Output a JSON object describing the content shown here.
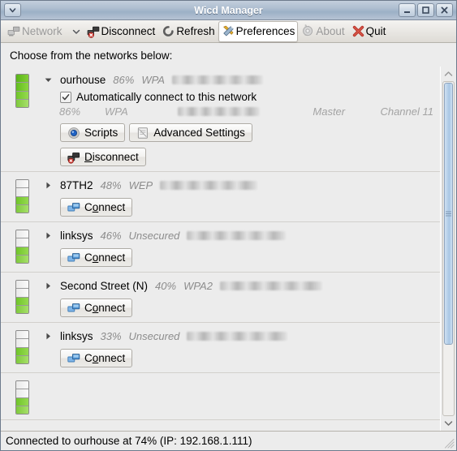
{
  "window": {
    "title": "Wicd Manager",
    "menu_button_icon": "chevron-down-icon",
    "minimize_label": "Minimize",
    "maximize_label": "Maximize",
    "close_label": "Close"
  },
  "toolbar": {
    "items": [
      {
        "label": "Network",
        "icon": "network-icon",
        "has_dropdown": true,
        "enabled": true,
        "active": false
      },
      {
        "label": "Disconnect",
        "icon": "disconnect-icon",
        "has_dropdown": false,
        "enabled": true,
        "active": false
      },
      {
        "label": "Refresh",
        "icon": "refresh-icon",
        "has_dropdown": false,
        "enabled": true,
        "active": false
      },
      {
        "label": "Preferences",
        "icon": "preferences-icon",
        "has_dropdown": false,
        "enabled": true,
        "active": true
      },
      {
        "label": "About",
        "icon": "about-gear-icon",
        "has_dropdown": false,
        "enabled": false,
        "active": false
      },
      {
        "label": "Quit",
        "icon": "quit-x-icon",
        "has_dropdown": false,
        "enabled": true,
        "active": false
      }
    ]
  },
  "main": {
    "prompt": "Choose from the networks below:",
    "networks": [
      {
        "essid": "ourhouse",
        "strength": "86%",
        "encryption": "WPA",
        "bars": 4,
        "expanded": true,
        "mac_hidden": true,
        "mac_width": 112,
        "details": {
          "strength": "86%",
          "encryption": "WPA",
          "mac_hidden": true,
          "mac_width": 112,
          "mode": "Master",
          "channel": "Channel 11"
        },
        "autoconnect": {
          "label": "Automatically connect to this network",
          "checked": true
        },
        "buttons": [
          {
            "label": "Scripts",
            "icon": "scripts-icon",
            "accel": ""
          },
          {
            "label": "Advanced Settings",
            "icon": "advanced-settings-icon",
            "accel": ""
          }
        ],
        "action": {
          "label": "Disconnect",
          "accel": "D",
          "icon": "disconnect-icon"
        }
      },
      {
        "essid": "87TH2",
        "strength": "48%",
        "encryption": "WEP",
        "bars": 2,
        "expanded": false,
        "mac_hidden": true,
        "mac_width": 120,
        "action": {
          "label": "Connect",
          "accel": "o",
          "icon": "connect-icon"
        }
      },
      {
        "essid": "linksys",
        "strength": "46%",
        "encryption": "Unsecured",
        "bars": 2,
        "expanded": false,
        "mac_hidden": true,
        "mac_width": 122,
        "action": {
          "label": "Connect",
          "accel": "o",
          "icon": "connect-icon"
        }
      },
      {
        "essid": "Second Street (N)",
        "strength": "40%",
        "encryption": "WPA2",
        "bars": 2,
        "expanded": false,
        "mac_hidden": true,
        "mac_width": 126,
        "action": {
          "label": "Connect",
          "accel": "o",
          "icon": "connect-icon"
        }
      },
      {
        "essid": "linksys",
        "strength": "33%",
        "encryption": "Unsecured",
        "bars": 2,
        "expanded": false,
        "mac_hidden": true,
        "mac_width": 124,
        "action": {
          "label": "Connect",
          "accel": "o",
          "icon": "connect-icon"
        }
      }
    ]
  },
  "scrollbar": {
    "up_icon": "chevron-up-icon",
    "down_icon": "chevron-down-icon",
    "thumb_position_percent": 0,
    "thumb_size_percent": 78
  },
  "statusbar": {
    "text": "Connected to ourhouse at 74% (IP: 192.168.1.111)"
  },
  "colors": {
    "titlebar_top": "#c3cfdd",
    "titlebar_bottom": "#b7c4d4",
    "window_bg": "#ececec",
    "signal_green": "#7ec93c",
    "scrollbar_thumb": "#b9d2ea",
    "meta_text": "#8c8c8c",
    "quit_red": "#c0392b"
  }
}
